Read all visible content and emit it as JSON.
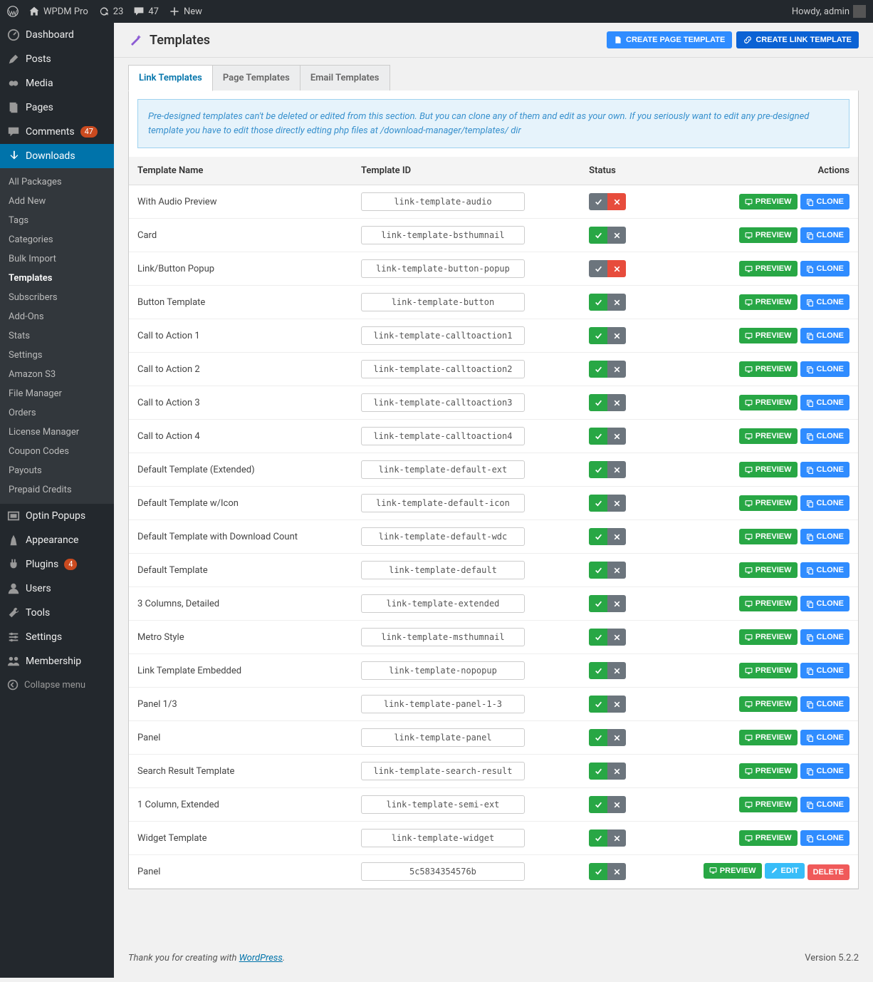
{
  "adminBar": {
    "site": "WPDM Pro",
    "updates": "23",
    "comments": "47",
    "new": "New",
    "greeting": "Howdy, admin"
  },
  "menu": {
    "dashboard": "Dashboard",
    "posts": "Posts",
    "media": "Media",
    "pages": "Pages",
    "commentsLabel": "Comments",
    "commentsBadge": "47",
    "downloads": "Downloads",
    "sub": {
      "allPackages": "All Packages",
      "addNew": "Add New",
      "tags": "Tags",
      "categories": "Categories",
      "bulkImport": "Bulk Import",
      "templates": "Templates",
      "subscribers": "Subscribers",
      "addOns": "Add-Ons",
      "stats": "Stats",
      "settings": "Settings",
      "amazonS3": "Amazon S3",
      "fileManager": "File Manager",
      "orders": "Orders",
      "licenseManager": "License Manager",
      "couponCodes": "Coupon Codes",
      "payouts": "Payouts",
      "prepaidCredits": "Prepaid Credits"
    },
    "optinPopups": "Optin Popups",
    "appearance": "Appearance",
    "pluginsLabel": "Plugins",
    "pluginsBadge": "4",
    "users": "Users",
    "tools": "Tools",
    "settingsMain": "Settings",
    "membership": "Membership",
    "collapse": "Collapse menu"
  },
  "page": {
    "title": "Templates",
    "createPage": "Create Page Template",
    "createLink": "Create Link Template"
  },
  "tabs": {
    "link": "Link Templates",
    "page": "Page Templates",
    "email": "Email Templates"
  },
  "notice": "Pre-designed templates can't be deleted or edited from this section. But you can clone any of them and edit as your own. If you seriously want to edit any pre-designed template you have to edit those directly edting php files at /download-manager/templates/ dir",
  "columns": {
    "name": "Template Name",
    "id": "Template ID",
    "status": "Status",
    "actions": "Actions"
  },
  "actionLabels": {
    "preview": "PREVIEW",
    "clone": "CLONE",
    "edit": "EDIT",
    "delete": "DELETE"
  },
  "rows": [
    {
      "name": "With Audio Preview",
      "id": "link-template-audio",
      "status": "off",
      "actions": "pc"
    },
    {
      "name": "Card",
      "id": "link-template-bsthumnail",
      "status": "on",
      "actions": "pc"
    },
    {
      "name": "Link/Button Popup",
      "id": "link-template-button-popup",
      "status": "off",
      "actions": "pc"
    },
    {
      "name": "Button Template",
      "id": "link-template-button",
      "status": "on",
      "actions": "pc"
    },
    {
      "name": "Call to Action 1",
      "id": "link-template-calltoaction1",
      "status": "on",
      "actions": "pc"
    },
    {
      "name": "Call to Action 2",
      "id": "link-template-calltoaction2",
      "status": "on",
      "actions": "pc"
    },
    {
      "name": "Call to Action 3",
      "id": "link-template-calltoaction3",
      "status": "on",
      "actions": "pc"
    },
    {
      "name": "Call to Action 4",
      "id": "link-template-calltoaction4",
      "status": "on",
      "actions": "pc"
    },
    {
      "name": "Default Template (Extended)",
      "id": "link-template-default-ext",
      "status": "on",
      "actions": "pc"
    },
    {
      "name": "Default Template w/Icon",
      "id": "link-template-default-icon",
      "status": "on",
      "actions": "pc"
    },
    {
      "name": "Default Template with Download Count",
      "id": "link-template-default-wdc",
      "status": "on",
      "actions": "pc"
    },
    {
      "name": "Default Template",
      "id": "link-template-default",
      "status": "on",
      "actions": "pc"
    },
    {
      "name": "3 Columns, Detailed",
      "id": "link-template-extended",
      "status": "on",
      "actions": "pc"
    },
    {
      "name": "Metro Style",
      "id": "link-template-msthumnail",
      "status": "on",
      "actions": "pc"
    },
    {
      "name": "Link Template Embedded",
      "id": "link-template-nopopup",
      "status": "on",
      "actions": "pc"
    },
    {
      "name": "Panel 1/3",
      "id": "link-template-panel-1-3",
      "status": "on",
      "actions": "pc"
    },
    {
      "name": "Panel",
      "id": "link-template-panel",
      "status": "on",
      "actions": "pc"
    },
    {
      "name": "Search Result Template",
      "id": "link-template-search-result",
      "status": "on",
      "actions": "pc"
    },
    {
      "name": "1 Column, Extended",
      "id": "link-template-semi-ext",
      "status": "on",
      "actions": "pc"
    },
    {
      "name": "Widget Template",
      "id": "link-template-widget",
      "status": "on",
      "actions": "pc"
    },
    {
      "name": "Panel",
      "id": "5c5834354576b",
      "status": "on",
      "actions": "ped"
    }
  ],
  "footer": {
    "thank": "Thank you for creating with ",
    "wp": "WordPress",
    "dot": ".",
    "version": "Version 5.2.2"
  }
}
